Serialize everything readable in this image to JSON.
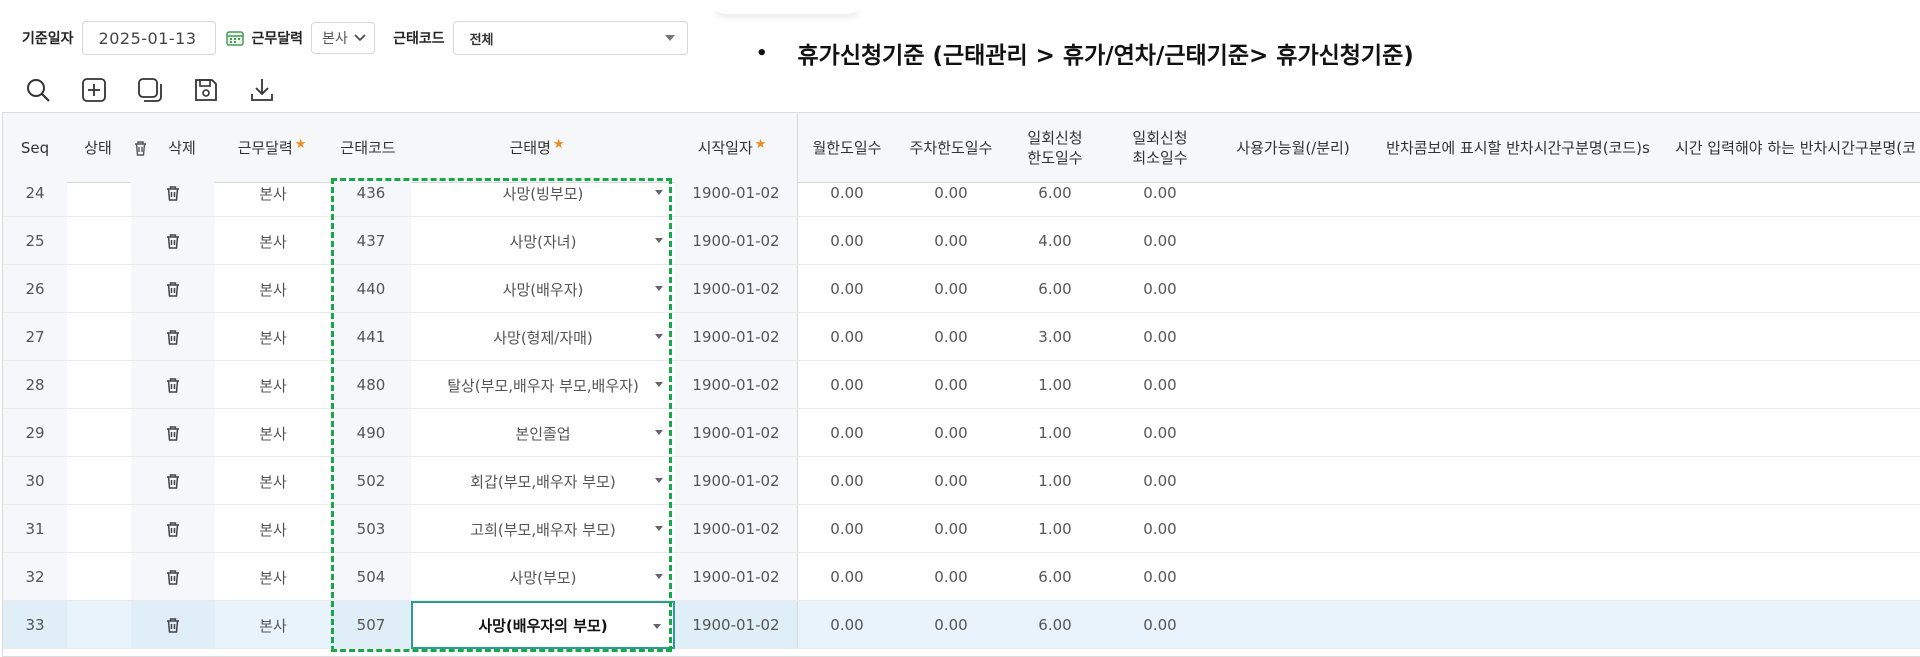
{
  "filters": {
    "base_date_label": "기준일자",
    "base_date_value": "2025-01-13",
    "calendar_label": "근무달력",
    "calendar_value": "본사",
    "code_label": "근태코드",
    "code_value": "전체"
  },
  "note": {
    "bullet": "•",
    "text": "휴가신청기준 (근태관리 > 휴가/연차/근태기준> 휴가신청기준)"
  },
  "toolbar": [
    "search-icon",
    "add-icon",
    "copy-icon",
    "save-icon",
    "download-icon"
  ],
  "colors": {
    "accent_star": "#f08c1a",
    "dash_box": "#18a84c",
    "edit_border": "#2a9d8f",
    "selected_row": "#e8f3fb"
  },
  "columns": {
    "seq": "Seq",
    "status": "상태",
    "delete": "삭제",
    "calendar": "근무달력",
    "code": "근태코드",
    "name": "근태명",
    "start": "시작일자",
    "month_limit": "월한도일수",
    "week_limit": "주차한도일수",
    "once_limit_1": "일회신청",
    "once_limit_2": "한도일수",
    "once_min_1": "일회신청",
    "once_min_2": "최소일수",
    "usable": "사용가능월(/분리)",
    "halfday_combo": "반차콤보에 표시할 반차시간구분명(코드)s",
    "time_input": "시간 입력해야 하는 반차시간구분명(코"
  },
  "rows": [
    {
      "seq": "24",
      "calendar": "본사",
      "code": "436",
      "name": "사망(빙부모)",
      "start": "1900-01-02",
      "month": "0.00",
      "week": "0.00",
      "once": "6.00",
      "min": "0.00"
    },
    {
      "seq": "25",
      "calendar": "본사",
      "code": "437",
      "name": "사망(자녀)",
      "start": "1900-01-02",
      "month": "0.00",
      "week": "0.00",
      "once": "4.00",
      "min": "0.00"
    },
    {
      "seq": "26",
      "calendar": "본사",
      "code": "440",
      "name": "사망(배우자)",
      "start": "1900-01-02",
      "month": "0.00",
      "week": "0.00",
      "once": "6.00",
      "min": "0.00"
    },
    {
      "seq": "27",
      "calendar": "본사",
      "code": "441",
      "name": "사망(형제/자매)",
      "start": "1900-01-02",
      "month": "0.00",
      "week": "0.00",
      "once": "3.00",
      "min": "0.00"
    },
    {
      "seq": "28",
      "calendar": "본사",
      "code": "480",
      "name": "탈상(부모,배우자 부모,배우자)",
      "start": "1900-01-02",
      "month": "0.00",
      "week": "0.00",
      "once": "1.00",
      "min": "0.00"
    },
    {
      "seq": "29",
      "calendar": "본사",
      "code": "490",
      "name": "본인졸업",
      "start": "1900-01-02",
      "month": "0.00",
      "week": "0.00",
      "once": "1.00",
      "min": "0.00"
    },
    {
      "seq": "30",
      "calendar": "본사",
      "code": "502",
      "name": "회갑(부모,배우자 부모)",
      "start": "1900-01-02",
      "month": "0.00",
      "week": "0.00",
      "once": "1.00",
      "min": "0.00"
    },
    {
      "seq": "31",
      "calendar": "본사",
      "code": "503",
      "name": "고희(부모,배우자 부모)",
      "start": "1900-01-02",
      "month": "0.00",
      "week": "0.00",
      "once": "1.00",
      "min": "0.00"
    },
    {
      "seq": "32",
      "calendar": "본사",
      "code": "504",
      "name": "사망(부모)",
      "start": "1900-01-02",
      "month": "0.00",
      "week": "0.00",
      "once": "6.00",
      "min": "0.00"
    },
    {
      "seq": "33",
      "calendar": "본사",
      "code": "507",
      "name": "사망(배우자의 부모)",
      "start": "1900-01-02",
      "month": "0.00",
      "week": "0.00",
      "once": "6.00",
      "min": "0.00",
      "selected": true
    }
  ]
}
